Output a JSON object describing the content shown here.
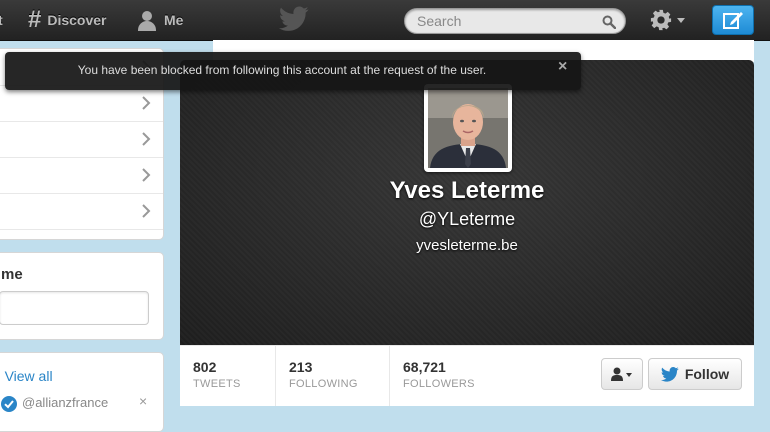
{
  "nav": {
    "home_fragment": "t",
    "discover_label": "Discover",
    "me_label": "Me",
    "search_placeholder": "Search"
  },
  "alert": {
    "message": "You have been blocked from following this account at the request of the user.",
    "close_glyph": "×"
  },
  "sidebar": {
    "name_fragment": "me",
    "view_all": {
      "prefix": "·",
      "link": "View all"
    },
    "suggestion_handle": "@allianzfrance",
    "dismiss_glyph": "×"
  },
  "profile": {
    "name": "Yves Leterme",
    "handle": "@YLeterme",
    "url": "yvesleterme.be"
  },
  "stats": [
    {
      "value": "802",
      "label": "TWEETS"
    },
    {
      "value": "213",
      "label": "FOLLOWING"
    },
    {
      "value": "68,721",
      "label": "FOLLOWERS"
    }
  ],
  "follow_label": "Follow",
  "colors": {
    "accent": "#2a85c7",
    "compose_button": "#1e8bd5",
    "topbar": "#2b2b2b",
    "background": "#c0deed"
  }
}
